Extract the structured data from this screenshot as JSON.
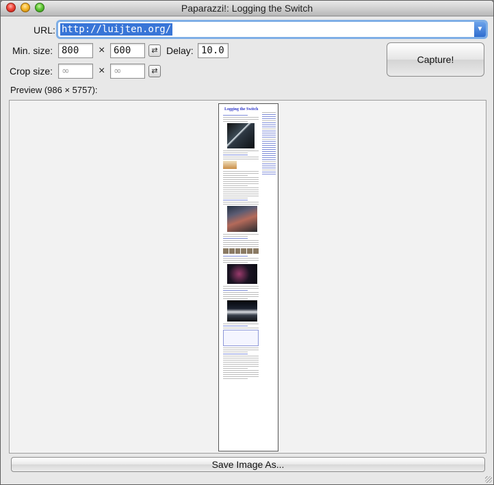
{
  "window": {
    "title": "Paparazzi!: Logging the Switch"
  },
  "url": {
    "label": "URL:",
    "value": "http://luijten.org/"
  },
  "min_size": {
    "label": "Min. size:",
    "width": "800",
    "height": "600",
    "times": "×"
  },
  "delay": {
    "label": "Delay:",
    "value": "10.0"
  },
  "crop_size": {
    "label": "Crop size:",
    "width_placeholder": "∞",
    "height_placeholder": "∞",
    "times": "×"
  },
  "capture_button": {
    "label": "Capture!"
  },
  "preview": {
    "label": "Preview (986 × 5757):",
    "page_title": "Logging the Switch"
  },
  "save_button": {
    "label": "Save Image As..."
  },
  "icons": {
    "close": "close-icon",
    "minimize": "minimize-icon",
    "zoom": "zoom-icon",
    "combo_arrow": "chevron-down-icon",
    "swap": "swap-icon",
    "resize": "resize-grip-icon"
  }
}
